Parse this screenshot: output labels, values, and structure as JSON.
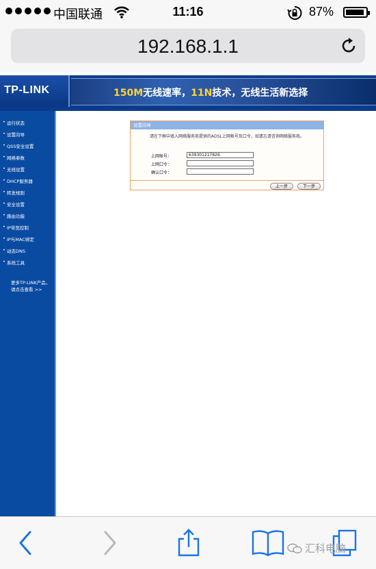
{
  "status_bar": {
    "carrier": "中国联通",
    "time": "11:16",
    "battery_percent": "87%",
    "signal_icon": "signal-dots-icon",
    "wifi_icon": "wifi-icon",
    "lock_icon": "orientation-lock-icon",
    "battery_icon": "battery-icon"
  },
  "browser": {
    "url": "192.168.1.1",
    "reload_icon": "reload-icon"
  },
  "router": {
    "logo": "TP-LINK",
    "slogan_hl1": "150M",
    "slogan_mid": "无线速率，",
    "slogan_hl2": "11N",
    "slogan_end": "技术，无线生活新选择",
    "menu": [
      {
        "label": "运行状态"
      },
      {
        "label": "设置向导"
      },
      {
        "label": "QSS安全设置"
      },
      {
        "label": "网络参数"
      },
      {
        "label": "无线设置"
      },
      {
        "label": "DHCP服务器"
      },
      {
        "label": "转发规则"
      },
      {
        "label": "安全设置"
      },
      {
        "label": "路由功能"
      },
      {
        "label": "IP带宽控制"
      },
      {
        "label": "IP与MAC绑定"
      },
      {
        "label": "动态DNS"
      },
      {
        "label": "系统工具"
      }
    ],
    "more_line1": "更多TP-LINK产品，",
    "more_line2": "请点击查看 >>",
    "wizard": {
      "title": "设置向导",
      "description": "请在下框中填入网络服务商提供的ADSL上网帐号及口令，如遗忘请咨询网络服务商。",
      "account_label": "上网帐号：",
      "account_value": "639301217826",
      "password_label": "上网口令：",
      "password_value": "",
      "confirm_label": "确认口令：",
      "confirm_value": "",
      "prev_button": "上一步",
      "next_button": "下一步"
    }
  },
  "toolbar": {
    "back_icon": "back-arrow-icon",
    "forward_icon": "forward-arrow-icon",
    "share_icon": "share-icon",
    "bookmarks_icon": "bookmarks-book-icon",
    "tabs_icon": "tabs-icon"
  },
  "watermark": {
    "text": "汇科电脑"
  },
  "colors": {
    "sidebar_blue": "#0a4ba2",
    "banner_blue": "#0b3b8c",
    "panel_border": "#f0a060",
    "panel_title": "#8eb3e6",
    "ios_blue": "#1a73e8",
    "slogan_highlight": "#ffd23a"
  }
}
